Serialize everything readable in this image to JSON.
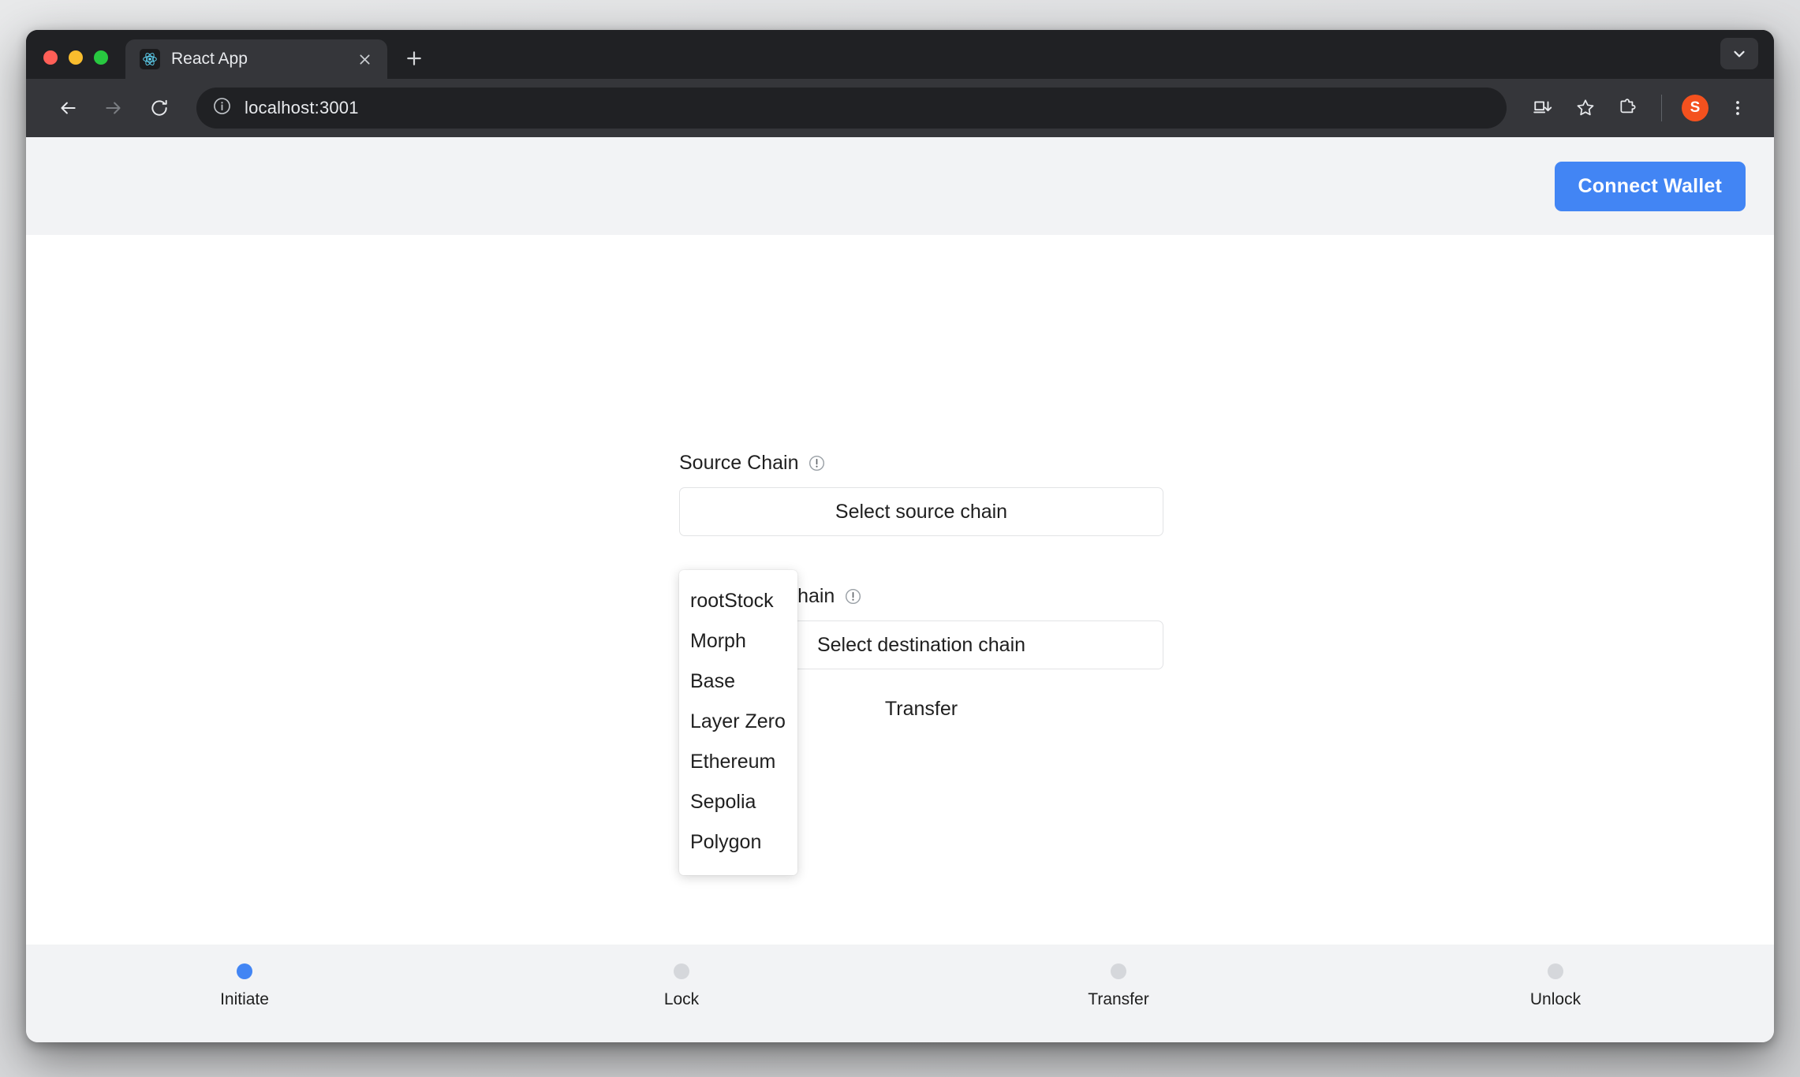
{
  "browser": {
    "tab": {
      "title": "React App",
      "favicon_icon": "react-logo-icon",
      "close_icon": "close-icon"
    },
    "new_tab_icon": "plus-icon",
    "tabstrip_chevron_icon": "chevron-down-icon",
    "nav": {
      "back_icon": "back-arrow-icon",
      "forward_icon": "forward-arrow-icon",
      "reload_icon": "reload-icon"
    },
    "omnibox": {
      "site_info_icon": "info-circle-icon",
      "url": "localhost:3001"
    },
    "toolbar_icons": [
      {
        "name": "install-app-icon"
      },
      {
        "name": "bookmark-star-icon"
      },
      {
        "name": "extensions-puzzle-icon"
      }
    ],
    "profile": {
      "initial": "S",
      "color": "#f4511e"
    },
    "menu_icon": "three-dot-menu-icon"
  },
  "app": {
    "header": {
      "connect_wallet_label": "Connect Wallet",
      "accent_color": "#4285f4"
    },
    "form": {
      "source": {
        "label": "Source Chain",
        "alert_icon": "alert-circle-icon",
        "button_label": "Select source chain"
      },
      "destination": {
        "label": "Destination Chain",
        "alert_icon": "alert-circle-icon",
        "button_label": "Select destination chain"
      },
      "transfer_label": "Transfer"
    },
    "dropdown": {
      "open": true,
      "options": [
        "rootStock",
        "Morph",
        "Base",
        "Layer Zero",
        "Ethereum",
        "Sepolia",
        "Polygon"
      ]
    },
    "stepper": {
      "active_color": "#4285f4",
      "inactive_color": "#d5d7db",
      "steps": [
        {
          "label": "Initiate",
          "active": true
        },
        {
          "label": "Lock",
          "active": false
        },
        {
          "label": "Transfer",
          "active": false
        },
        {
          "label": "Unlock",
          "active": false
        }
      ]
    }
  }
}
